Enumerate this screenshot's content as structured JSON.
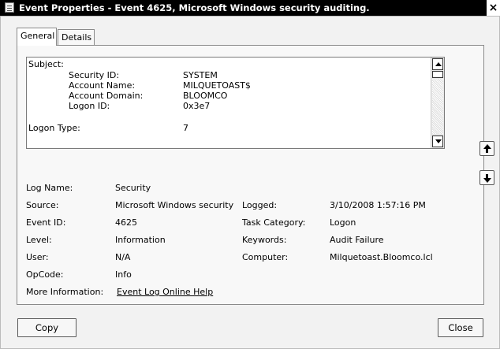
{
  "window": {
    "title": "Event Properties - Event 4625, Microsoft Windows security auditing.",
    "close_glyph": "×"
  },
  "tabs": [
    {
      "label": "General"
    },
    {
      "label": "Details"
    }
  ],
  "description": {
    "subject_header": "Subject:",
    "rows": [
      {
        "label": "Security ID:",
        "value": "SYSTEM"
      },
      {
        "label": "Account Name:",
        "value": "MILQUETOAST$"
      },
      {
        "label": "Account Domain:",
        "value": "BLOOMCO"
      },
      {
        "label": "Logon ID:",
        "value": "0x3e7"
      }
    ],
    "logon_type_label": "Logon Type:",
    "logon_type_value": "7"
  },
  "details": {
    "log_name": {
      "label": "Log Name:",
      "value": "Security"
    },
    "source": {
      "label": "Source:",
      "value": "Microsoft Windows security"
    },
    "logged": {
      "label": "Logged:",
      "value": "3/10/2008 1:57:16 PM"
    },
    "event_id": {
      "label": "Event ID:",
      "value": "4625"
    },
    "task_category": {
      "label": "Task Category:",
      "value": "Logon"
    },
    "level": {
      "label": "Level:",
      "value": "Information"
    },
    "keywords": {
      "label": "Keywords:",
      "value": "Audit Failure"
    },
    "user": {
      "label": "User:",
      "value": "N/A"
    },
    "computer": {
      "label": "Computer:",
      "value": "Milquetoast.Bloomco.lcl"
    },
    "opcode": {
      "label": "OpCode:",
      "value": "Info"
    },
    "more_info": {
      "label": "More Information:",
      "link": "Event Log Online Help"
    }
  },
  "buttons": {
    "copy": "Copy",
    "close": "Close"
  }
}
